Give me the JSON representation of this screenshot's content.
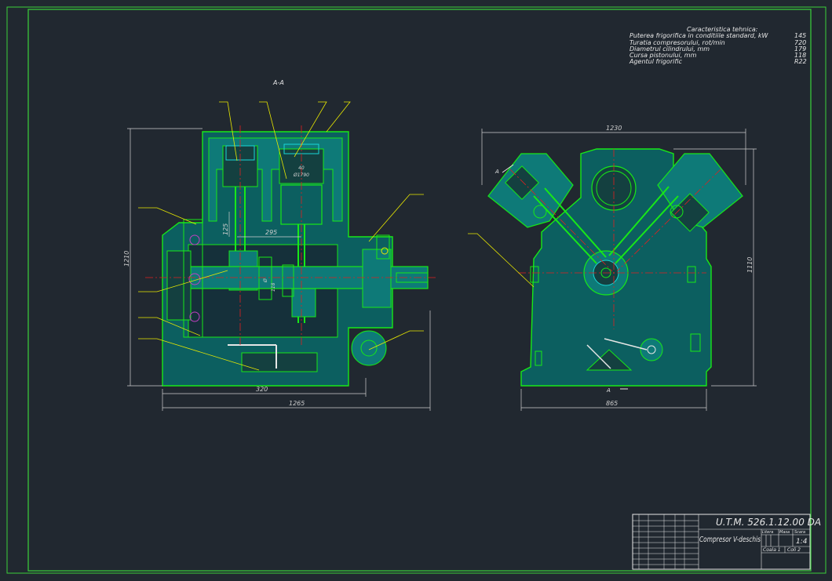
{
  "colors": {
    "background": "#212830",
    "frame": "#3ad13a",
    "outline": "#18e818",
    "section_fill": "#0e7a78",
    "body_fill": "#0c5f60",
    "text": "#e6e6e6",
    "dimension": "#cfcfcf",
    "center_line": "#e02020",
    "leader": "#e8e800",
    "detail_cyan": "#18d8d8",
    "detail_magenta": "#c040c0"
  },
  "tech_specs": {
    "title": "Caracteristica tehnica:",
    "rows": [
      {
        "label": "Puterea frigorifica in conditiile standard, kW",
        "value": "145"
      },
      {
        "label": "Turatia compresorului, rot/min",
        "value": "720"
      },
      {
        "label": "Diametrul cilindrului, mm",
        "value": "179"
      },
      {
        "label": "Cursa pistonului, mm",
        "value": "118"
      },
      {
        "label": "Agentul frigorific",
        "value": "R22"
      }
    ]
  },
  "section_label": "A-A",
  "section_marker": "A",
  "dimensions": {
    "left_height": "1210",
    "left_width_total": "1265",
    "left_width_partial": "320",
    "left_inner_horizontal": "295",
    "left_inner_vertical": "125",
    "left_piston_a": "40",
    "left_piston_b": "Ø1790",
    "left_crank_a": "Ø",
    "left_crank_b": "118",
    "right_width_top": "1230",
    "right_width_bottom": "865",
    "right_height": "1110"
  },
  "title_block": {
    "drawing_code": "U.T.M. 526.1.12.00 DA",
    "name": "Compresor V-deschis",
    "scale": "1:4",
    "col_litera": "Litera",
    "col_masa": "Masa",
    "col_scara": "Scara",
    "sheet": "Coala 1",
    "sheets": "Coli 2"
  }
}
